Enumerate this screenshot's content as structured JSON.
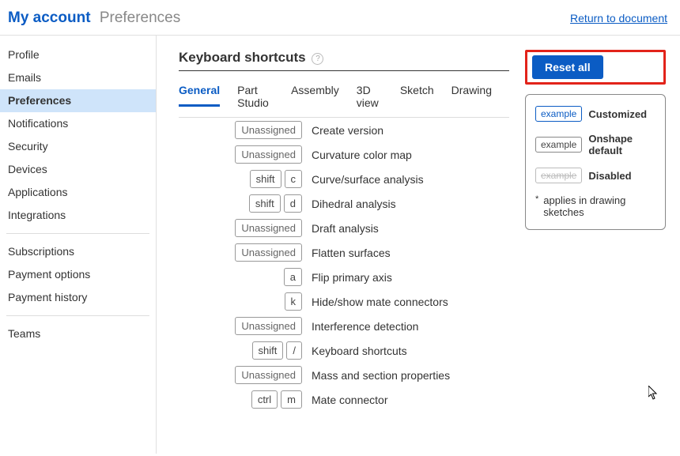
{
  "header": {
    "breadcrumb_root": "My account",
    "breadcrumb_current": "Preferences",
    "return_link": "Return to document"
  },
  "sidebar": {
    "groups": [
      [
        "Profile",
        "Emails",
        "Preferences",
        "Notifications",
        "Security",
        "Devices",
        "Applications",
        "Integrations"
      ],
      [
        "Subscriptions",
        "Payment options",
        "Payment history"
      ],
      [
        "Teams"
      ]
    ],
    "active": "Preferences"
  },
  "heading": "Keyboard shortcuts",
  "tabs": [
    "General",
    "Part Studio",
    "Assembly",
    "3D view",
    "Sketch",
    "Drawing"
  ],
  "active_tab": "General",
  "reset_label": "Reset all",
  "shortcuts": [
    {
      "keys": [
        "Unassigned"
      ],
      "unassigned": true,
      "label": "Create version"
    },
    {
      "keys": [
        "Unassigned"
      ],
      "unassigned": true,
      "label": "Curvature color map"
    },
    {
      "keys": [
        "shift",
        "c"
      ],
      "label": "Curve/surface analysis"
    },
    {
      "keys": [
        "shift",
        "d"
      ],
      "label": "Dihedral analysis"
    },
    {
      "keys": [
        "Unassigned"
      ],
      "unassigned": true,
      "label": "Draft analysis"
    },
    {
      "keys": [
        "Unassigned"
      ],
      "unassigned": true,
      "label": "Flatten surfaces"
    },
    {
      "keys": [
        "a"
      ],
      "label": "Flip primary axis"
    },
    {
      "keys": [
        "k"
      ],
      "label": "Hide/show mate connectors"
    },
    {
      "keys": [
        "Unassigned"
      ],
      "unassigned": true,
      "label": "Interference detection"
    },
    {
      "keys": [
        "shift",
        "/"
      ],
      "label": "Keyboard shortcuts"
    },
    {
      "keys": [
        "Unassigned"
      ],
      "unassigned": true,
      "label": "Mass and section properties"
    },
    {
      "keys": [
        "ctrl",
        "m"
      ],
      "label": "Mate connector"
    }
  ],
  "legend": {
    "example_word": "example",
    "customized": "Customized",
    "default": "Onshape default",
    "disabled": "Disabled",
    "note_ast": "*",
    "note": "applies in drawing sketches"
  }
}
